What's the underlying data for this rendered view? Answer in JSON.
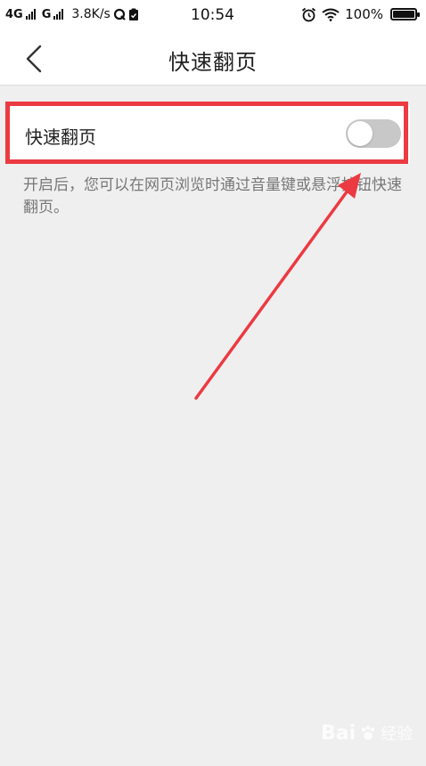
{
  "status_bar": {
    "network_1": "4G",
    "network_2": "G",
    "speed": "3.8K/s",
    "time": "10:54",
    "battery": "100%",
    "icons": [
      "signal-icon",
      "q-app-icon",
      "clipboard-icon",
      "alarm-icon",
      "wifi-icon",
      "battery-icon"
    ]
  },
  "header": {
    "title": "快速翻页",
    "back_icon": "chevron-left-icon"
  },
  "setting": {
    "label": "快速翻页",
    "enabled": false,
    "description": "开启后，您可以在网页浏览时通过音量键或悬浮按钮快速翻页。"
  },
  "annotation": {
    "highlight_color": "#ec3a42",
    "arrow_color": "#ec3a42"
  },
  "watermark": {
    "logo_text": "Bai",
    "suffix": "经验"
  },
  "colors": {
    "background": "#efefef",
    "card": "#ffffff",
    "toggle_off": "#c8c8c8",
    "text_primary": "#222222",
    "text_secondary": "#777777"
  }
}
